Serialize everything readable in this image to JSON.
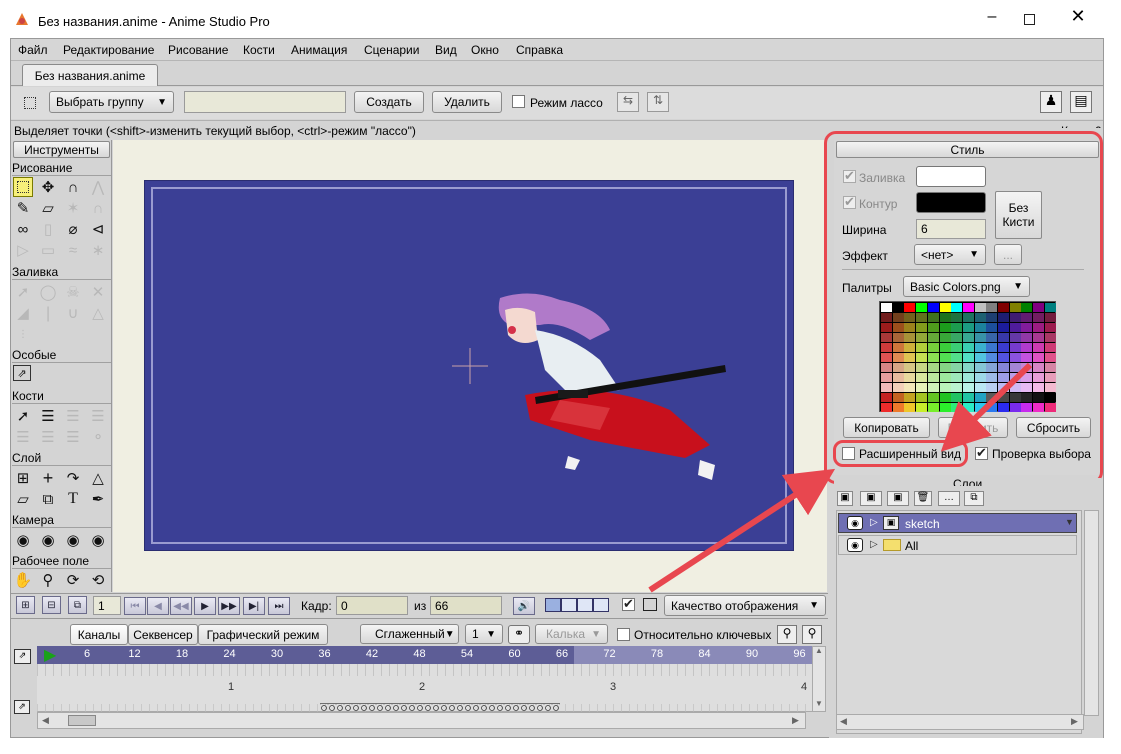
{
  "window": {
    "title": "Без названия.anime - Anime Studio Pro"
  },
  "menu": [
    "Файл",
    "Редактирование",
    "Рисование",
    "Кости",
    "Анимация",
    "Сценарии",
    "Вид",
    "Окно",
    "Справка"
  ],
  "doc_tab": "Без названия.anime",
  "toolbar": {
    "select_group": "Выбрать группу",
    "create": "Создать",
    "delete": "Удалить",
    "lasso_mode": "Режим лассо"
  },
  "status": {
    "hint": "Выделяет точки (<shift>-изменить текущий выбор, <ctrl>-режим \"лассо\")",
    "frame": "Кадр: 0"
  },
  "tools_panel": {
    "title": "Инструменты",
    "sections": [
      "Рисование",
      "Заливка",
      "Особые",
      "Кости",
      "Слой",
      "Камера",
      "Рабочее поле"
    ]
  },
  "style_panel": {
    "title": "Стиль",
    "fill_label": "Заливка",
    "stroke_label": "Контур",
    "width_label": "Ширина",
    "width_value": "6",
    "no_brush": "Без Кисти",
    "effect_label": "Эффект",
    "effect_value": "<нет>",
    "more_label": "...",
    "palettes_label": "Палитры",
    "palette_value": "Basic Colors.png",
    "copy": "Копировать",
    "paste": "Вставить",
    "reset": "Сбросить",
    "extended_view": "Расширенный вид",
    "check_selection": "Проверка выбора",
    "fill_color": "#ffffff",
    "stroke_color": "#000000"
  },
  "layers_panel": {
    "title": "Слои",
    "layers": [
      "sketch",
      "All"
    ]
  },
  "playback": {
    "current_frame": "1",
    "frame_label": "Кадр:",
    "frame_value": "0",
    "of_label": "из",
    "total_frames": "66",
    "quality": "Качество отображения"
  },
  "timeline": {
    "tabs": [
      "Каналы",
      "Секвенсер",
      "Графический режим"
    ],
    "interp": "Сглаженный",
    "interp_num": "1",
    "onion": "Калька",
    "relative_keys": "Относительно ключевых",
    "ruler": [
      "6",
      "12",
      "18",
      "24",
      "30",
      "36",
      "42",
      "48",
      "54",
      "60",
      "66",
      "72",
      "78",
      "84",
      "90",
      "96"
    ],
    "sub_ruler": [
      "1",
      "2",
      "3",
      "4"
    ]
  },
  "colors": {
    "canvas": "#3b3f95",
    "workspace": "#f0efe2",
    "accent_red": "#e8474f",
    "highlight_layer": "#6f6fb3"
  }
}
